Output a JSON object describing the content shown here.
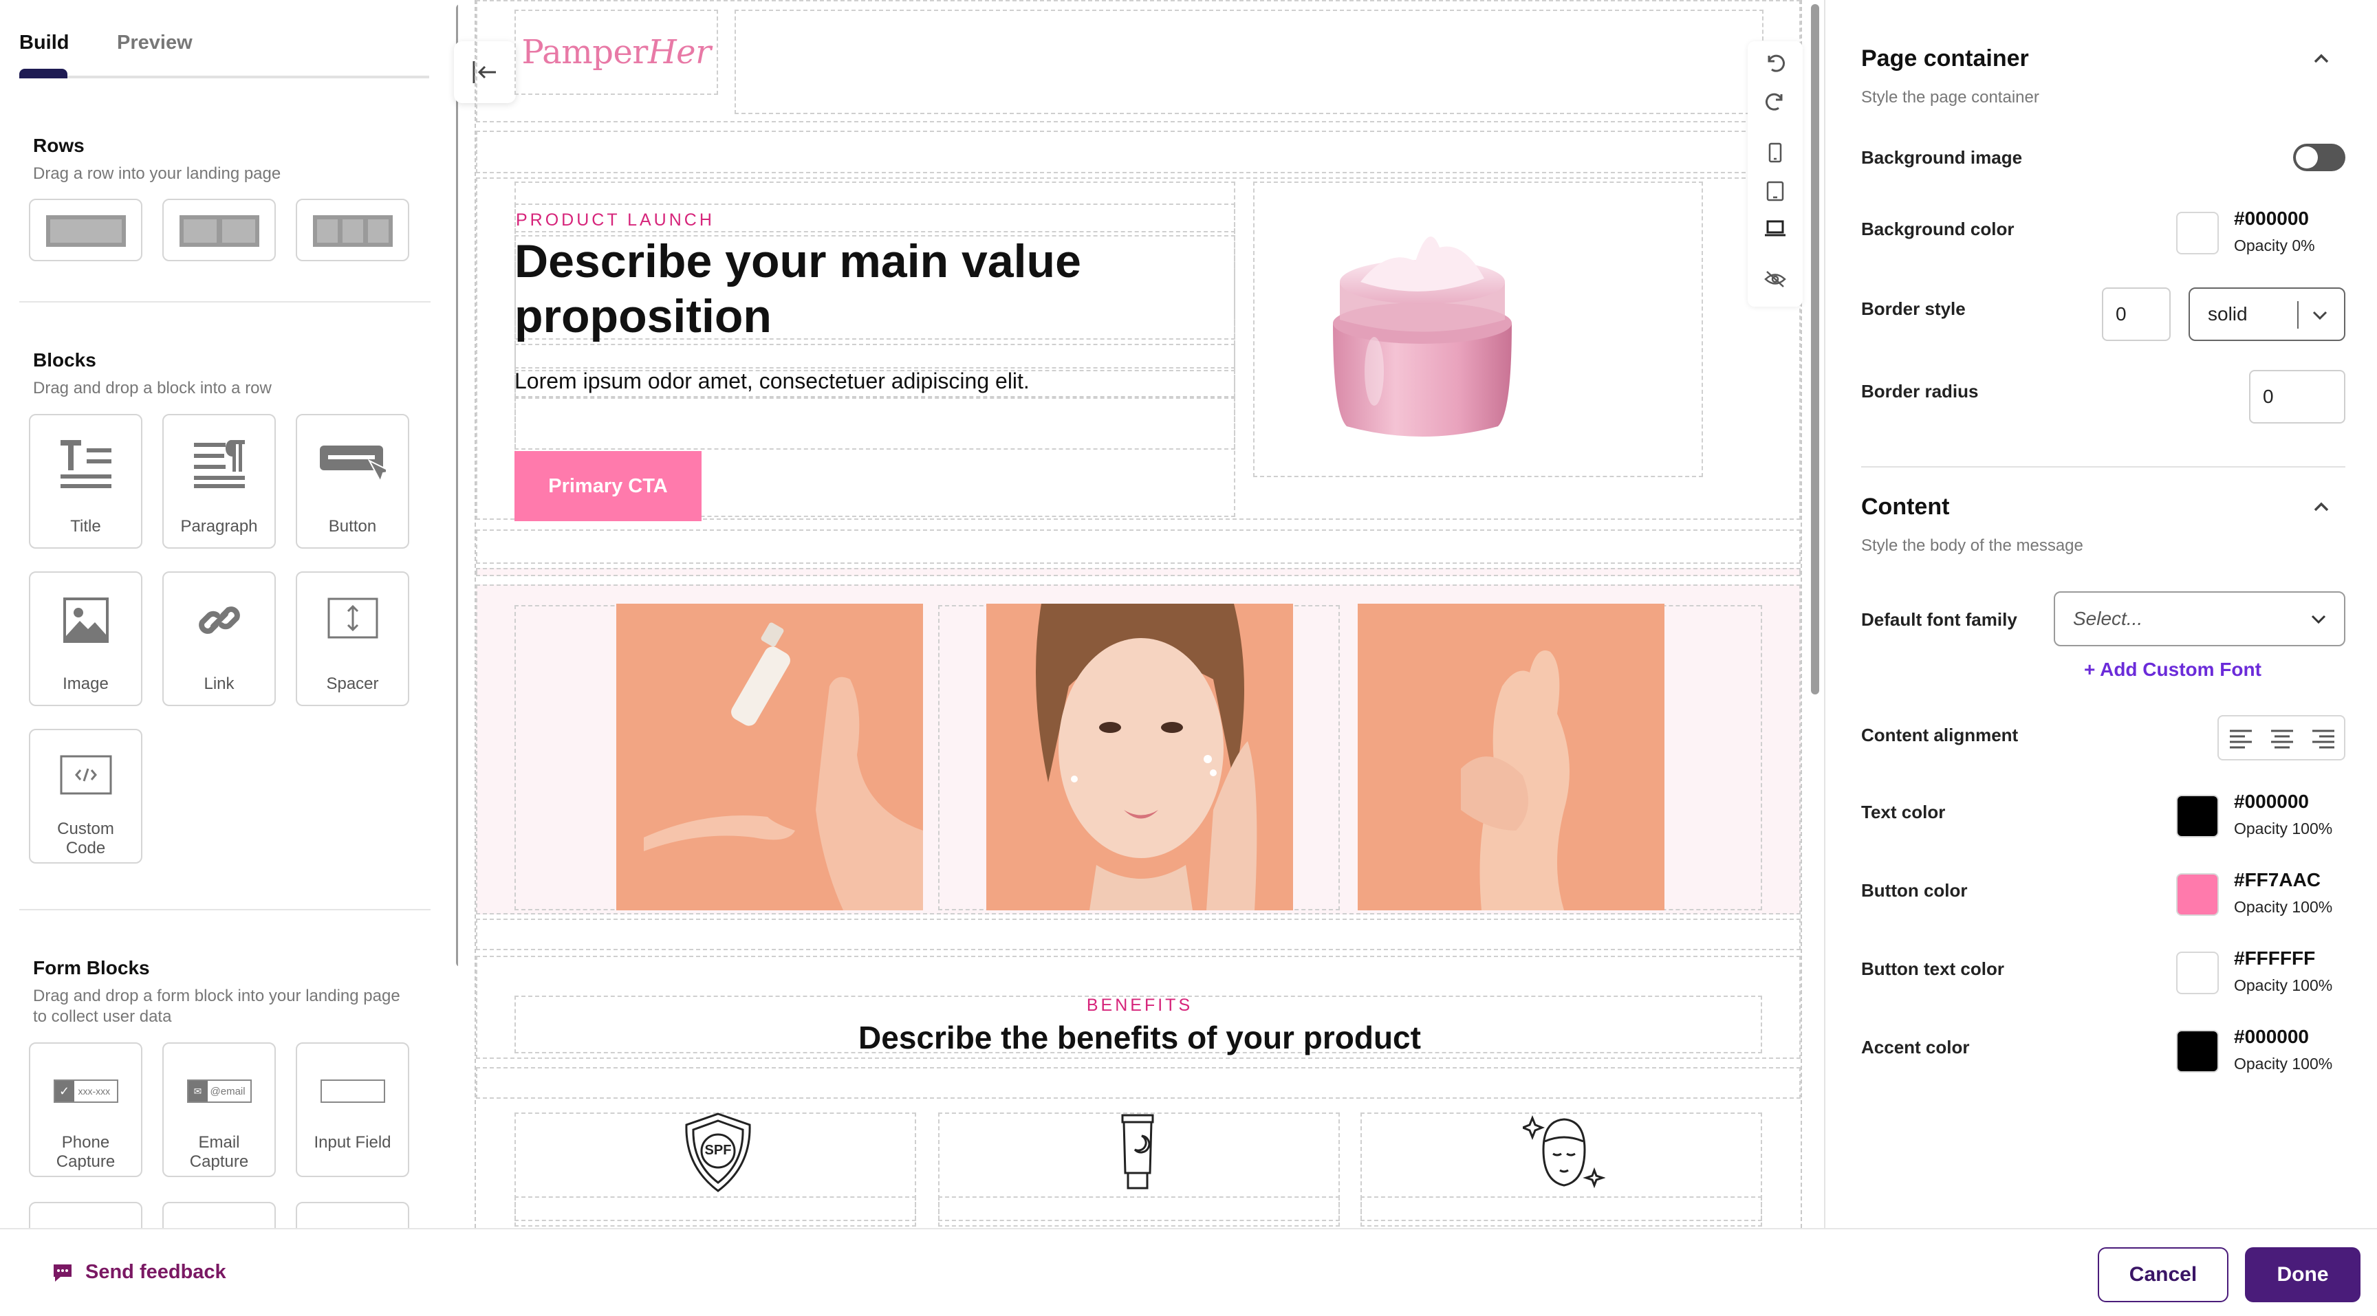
{
  "tabs": {
    "build": "Build",
    "preview": "Preview"
  },
  "rows": {
    "title": "Rows",
    "subtitle": "Drag a row into your landing page"
  },
  "blocks": {
    "title": "Blocks",
    "subtitle": "Drag and drop a block into a row",
    "items": [
      "Title",
      "Paragraph",
      "Button",
      "Image",
      "Link",
      "Spacer",
      "Custom Code"
    ]
  },
  "form_blocks": {
    "title": "Form Blocks",
    "subtitle": "Drag and drop a form block into your landing page to collect user data",
    "items": [
      "Phone Capture",
      "Email Capture",
      "Input Field"
    ],
    "phone_placeholder": "xxx-xxx",
    "email_placeholder": "@email"
  },
  "canvas": {
    "logo_main": "Pamper",
    "logo_italic": "Her",
    "eyebrow": "PRODUCT LAUNCH",
    "hero_title": "Describe your main value proposition",
    "hero_body": "Lorem ipsum odor amet, consectetuer adipiscing elit.",
    "cta_label": "Primary CTA",
    "benefits_eyebrow": "BENEFITS",
    "benefits_title": "Describe the benefits of your product",
    "spf_text": "SPF"
  },
  "page_container": {
    "title": "Page container",
    "subtitle": "Style the page container",
    "background_image_label": "Background image",
    "background_image_enabled": false,
    "background_color_label": "Background color",
    "background_color_hex": "#000000",
    "background_color_opacity": "Opacity 0%",
    "border_style_label": "Border style",
    "border_width": "0",
    "border_style_value": "solid",
    "border_radius_label": "Border radius",
    "border_radius_value": "0"
  },
  "content": {
    "title": "Content",
    "subtitle": "Style the body of the message",
    "font_family_label": "Default font family",
    "font_family_placeholder": "Select...",
    "add_custom_font": "+ Add Custom Font",
    "alignment_label": "Content alignment",
    "colors": [
      {
        "label": "Text color",
        "hex": "#000000",
        "opacity": "Opacity 100%"
      },
      {
        "label": "Button color",
        "hex": "#FF7AAC",
        "opacity": "Opacity 100%"
      },
      {
        "label": "Button text color",
        "hex": "#FFFFFF",
        "opacity": "Opacity 100%"
      },
      {
        "label": "Accent color",
        "hex": "#000000",
        "opacity": "Opacity 100%"
      }
    ]
  },
  "footer": {
    "feedback": "Send feedback",
    "cancel": "Cancel",
    "done": "Done"
  },
  "icons": {
    "collapse": "collapse-left-icon",
    "undo": "undo-icon",
    "redo": "redo-icon",
    "mobile": "mobile-icon",
    "tablet": "tablet-icon",
    "desktop": "desktop-icon",
    "hidden": "eye-off-icon",
    "feedback": "chat-bubble-icon"
  },
  "colors": {
    "brand_dark": "#4a1c7a",
    "cta": "#ff7aac",
    "accent_pink": "#d6247a",
    "add_font": "#6b2bd9",
    "feedback": "#7a1863"
  }
}
